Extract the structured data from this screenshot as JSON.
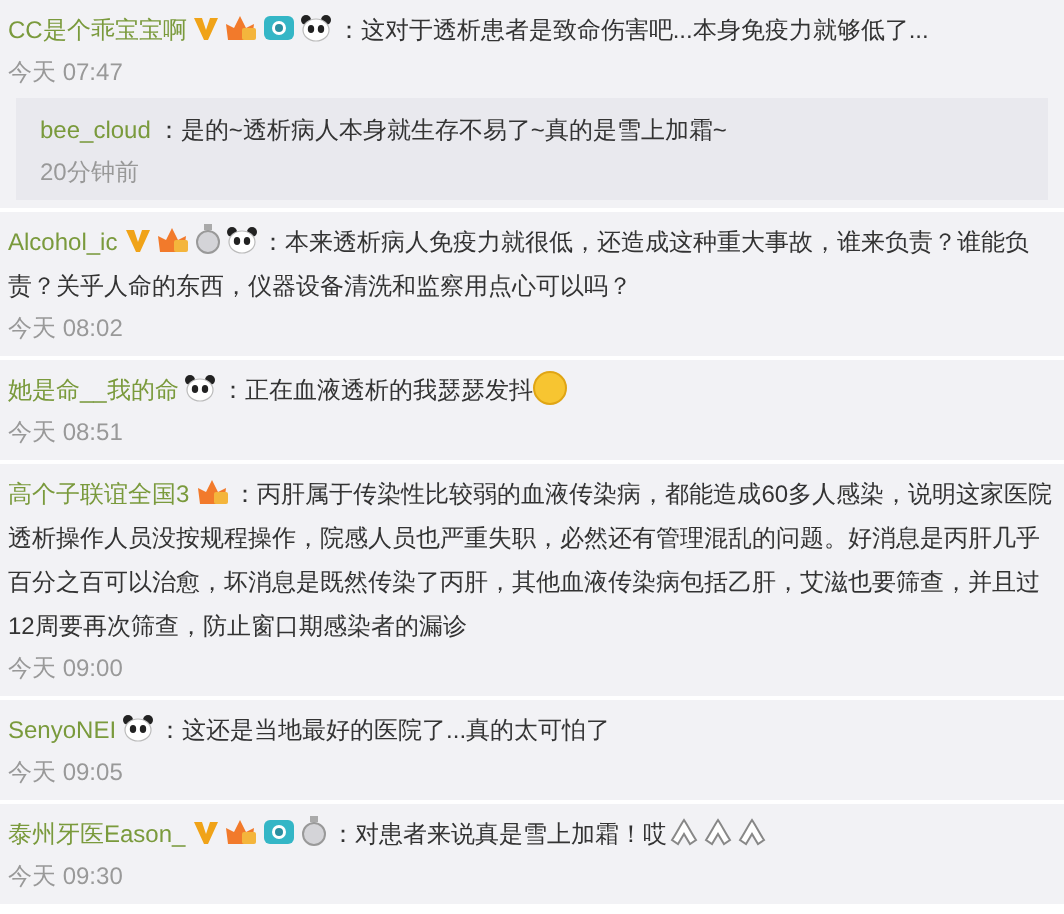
{
  "comments": [
    {
      "kind": "comment",
      "user": "CC是个乖宝宝啊",
      "badges": [
        {
          "kind": "v"
        },
        {
          "kind": "crown"
        },
        {
          "kind": "camera"
        },
        {
          "kind": "panda"
        }
      ],
      "text": "：这对于透析患者是致命伤害吧...本身免疫力就够低了...",
      "time": "今天 07:47",
      "replies": [
        {
          "user": "bee_cloud",
          "text": "：是的~透析病人本身就生存不易了~真的是雪上加霜~",
          "time": "20分钟前"
        }
      ]
    },
    {
      "kind": "comment",
      "user": "Alcohol_ic",
      "badges": [
        {
          "kind": "v"
        },
        {
          "kind": "crown"
        },
        {
          "kind": "medal"
        },
        {
          "kind": "panda"
        }
      ],
      "text": "：本来透析病人免疫力就很低，还造成这种重大事故，谁来负责？谁能负",
      "text_continued": "责？关乎人命的东西，仪器设备清洗和监察用点心可以吗？",
      "time": "今天 08:02"
    },
    {
      "kind": "comment",
      "user": "她是命__我的命",
      "badges": [
        {
          "kind": "panda"
        }
      ],
      "text": "：正在血液透析的我瑟瑟发抖",
      "emoji": [
        {
          "kind": "surprised"
        }
      ],
      "time": "今天 08:51"
    },
    {
      "kind": "comment",
      "user": "高个子联谊全国3",
      "badges": [
        {
          "kind": "crown"
        }
      ],
      "text": "：丙肝属于传染性比较弱的血液传染病，都能造成60多人感染，说明这家医院",
      "text_continued": "透析操作人员没按规程操作，院感人员也严重失职，必然还有管理混乱的问题。好消息是丙肝几乎百分之百可以治愈，坏消息是既然传染了丙肝，其他血液传染病包括乙肝，艾滋也要筛查，并且过12周要再次筛查，防止窗口期感染者的漏诊",
      "time": "今天 09:00"
    },
    {
      "kind": "comment",
      "user": "SenyoNEI",
      "badges": [
        {
          "kind": "panda"
        }
      ],
      "text": "：这还是当地最好的医院了...真的太可怕了",
      "time": "今天 09:05"
    },
    {
      "kind": "comment",
      "user": "泰州牙医Eason_",
      "badges": [
        {
          "kind": "v"
        },
        {
          "kind": "crown"
        },
        {
          "kind": "camera"
        },
        {
          "kind": "medal"
        }
      ],
      "text": "：对患者来说真是雪上加霜！哎",
      "emoji": [
        {
          "kind": "pray"
        },
        {
          "kind": "pray"
        },
        {
          "kind": "pray"
        }
      ],
      "time": "今天 09:30"
    }
  ]
}
